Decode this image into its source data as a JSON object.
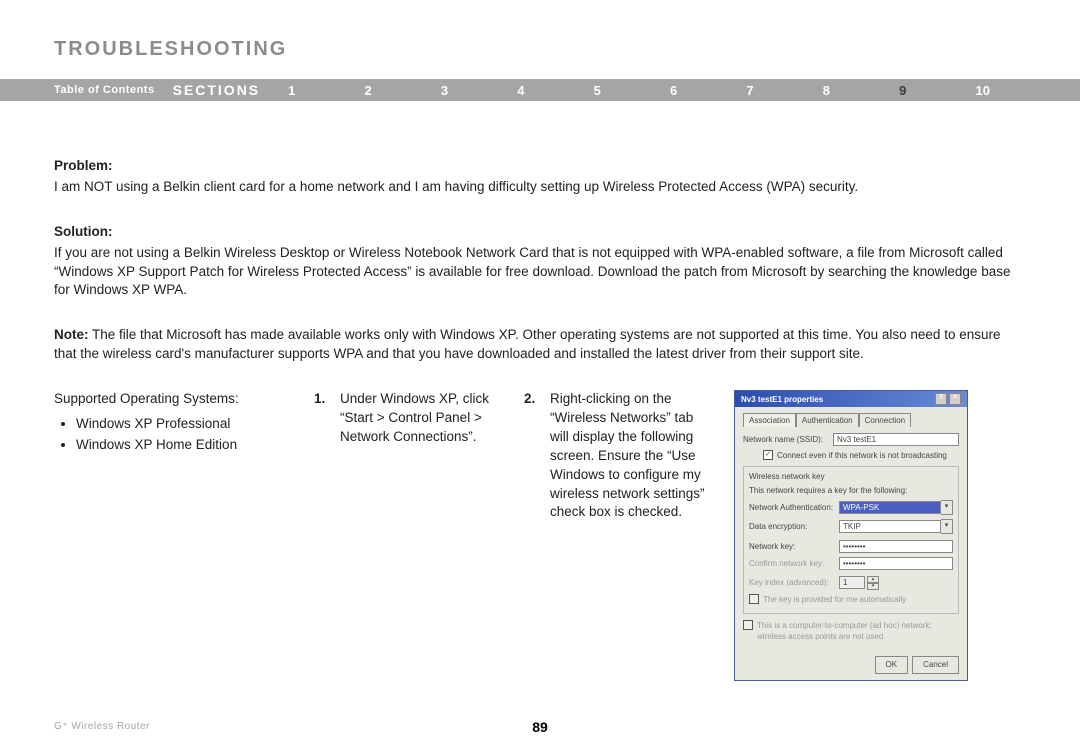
{
  "title": "TROUBLESHOOTING",
  "nav": {
    "toc": "Table of Contents",
    "sections": "SECTIONS",
    "numbers": [
      "1",
      "2",
      "3",
      "4",
      "5",
      "6",
      "7",
      "8",
      "9",
      "10"
    ],
    "activeIndex": 8
  },
  "problem": {
    "label": "Problem:",
    "text": "I am NOT using a Belkin client card for a home network and I am having difficulty setting up Wireless Protected Access (WPA) security."
  },
  "solution": {
    "label": "Solution:",
    "text": "If you are not using a Belkin Wireless Desktop or Wireless Notebook Network Card that is not equipped with WPA-enabled software, a file from Microsoft called “Windows XP Support Patch for Wireless Protected Access” is available for free download. Download the patch from Microsoft by searching the knowledge base for Windows XP WPA."
  },
  "note": {
    "label": "Note:",
    "text": " The file that Microsoft has made available works only with Windows XP. Other operating systems are not supported at this time. You also need to ensure that the wireless card's manufacturer supports WPA and that you have downloaded and installed the latest driver from their support site."
  },
  "supported": {
    "label": "Supported Operating Systems:",
    "items": [
      "Windows XP Professional",
      "Windows XP Home Edition"
    ]
  },
  "steps": {
    "s1": {
      "num": "1.",
      "text": "Under Windows XP, click “Start > Control Panel > Network Connections”."
    },
    "s2": {
      "num": "2.",
      "text": "Right-clicking on the “Wireless Networks” tab will display the following screen. Ensure the “Use Windows to configure my wireless network settings” check box is checked."
    }
  },
  "dialog": {
    "title": "Nv3 testE1 properties",
    "tabs": [
      "Association",
      "Authentication",
      "Connection"
    ],
    "ssid_label": "Network name (SSID):",
    "ssid_value": "Nv3 testE1",
    "connect_chk": "Connect even if this network is not broadcasting",
    "fs_key_title": "Wireless network key",
    "fs_key_desc": "This network requires a key for the following:",
    "auth_label": "Network Authentication:",
    "auth_value": "WPA-PSK",
    "enc_label": "Data encryption:",
    "enc_value": "TKIP",
    "netkey_label": "Network key:",
    "netkey_value": "••••••••",
    "confirm_label": "Confirm network key:",
    "confirm_value": "••••••••",
    "keyidx_label": "Key index (advanced):",
    "keyidx_value": "1",
    "auto_chk": "The key is provided for me automatically",
    "adhoc_chk": "This is a computer-to-computer (ad hoc) network; wireless access points are not used",
    "ok": "OK",
    "cancel": "Cancel"
  },
  "footer": {
    "left": "G⁺ Wireless Router",
    "page": "89"
  }
}
